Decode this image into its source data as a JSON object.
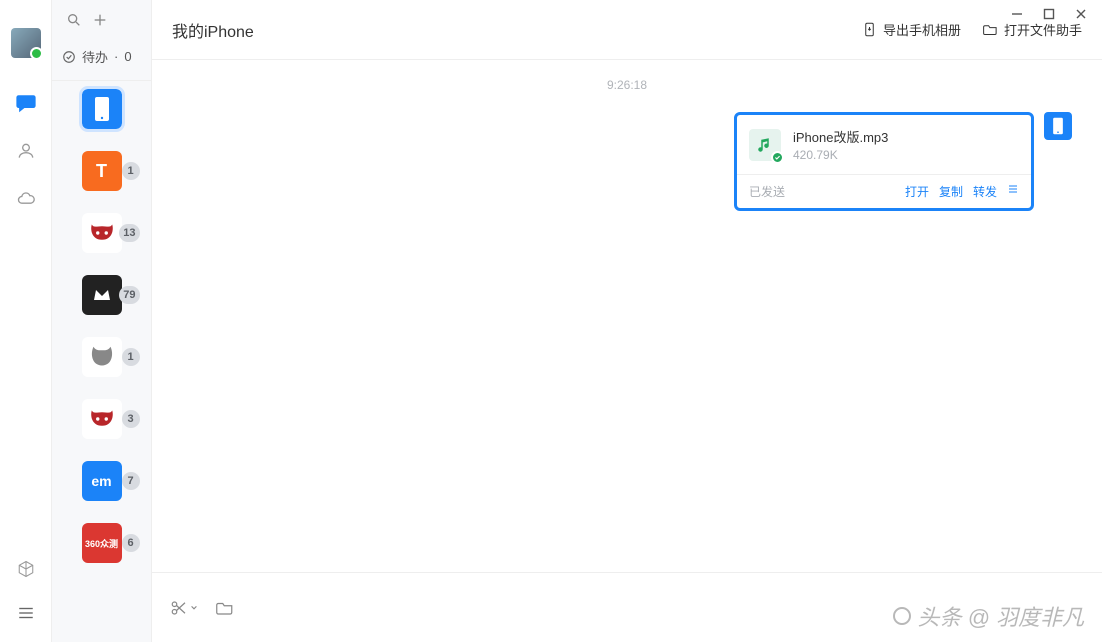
{
  "header": {
    "title": "我的iPhone",
    "export_album": "导出手机相册",
    "open_file_helper": "打开文件助手"
  },
  "todo": {
    "label": "待办",
    "count": "0"
  },
  "contacts": [
    {
      "id": "iphone",
      "badge": "",
      "selected": true
    },
    {
      "id": "t",
      "badge": "1"
    },
    {
      "id": "bull1",
      "badge": "13"
    },
    {
      "id": "crown",
      "badge": "79"
    },
    {
      "id": "gnu",
      "badge": "1"
    },
    {
      "id": "bull2",
      "badge": "3"
    },
    {
      "id": "em",
      "badge": "7",
      "label": "em"
    },
    {
      "id": "360",
      "badge": "6",
      "label": "360众测"
    }
  ],
  "chat": {
    "timestamp": "9:26:18",
    "file": {
      "name": "iPhone改版.mp3",
      "size": "420.79K"
    },
    "sent_status": "已发送",
    "actions": {
      "open": "打开",
      "copy": "复制",
      "forward": "转发"
    }
  },
  "watermark": "头条 @ 羽度非凡"
}
